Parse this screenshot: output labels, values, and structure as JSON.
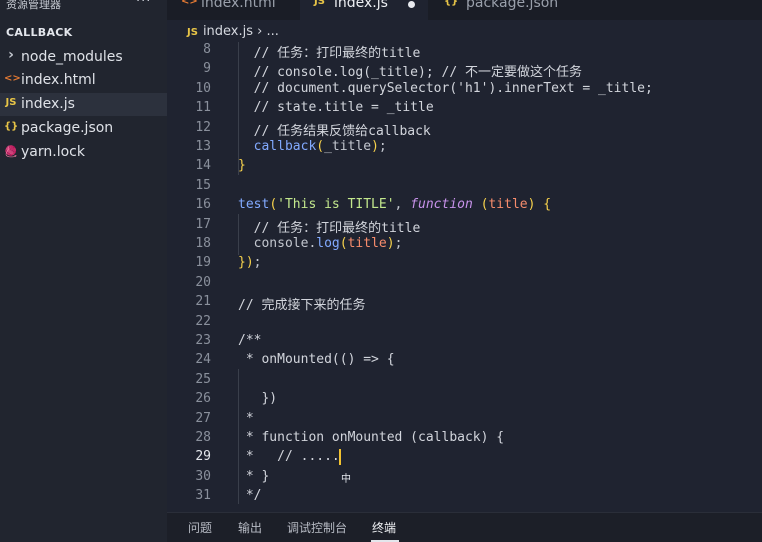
{
  "sidebar": {
    "title": "资源管理器",
    "more_label": "···",
    "section": "CALLBACK",
    "items": [
      {
        "icon": "›",
        "label": "node_modules",
        "icon_name": "chevron-right-icon"
      },
      {
        "icon": "<>",
        "label": "index.html",
        "icon_name": "html-file-icon"
      },
      {
        "icon": "JS",
        "label": "index.js",
        "icon_name": "js-file-icon"
      },
      {
        "icon": "{}",
        "label": "package.json",
        "icon_name": "json-file-icon"
      },
      {
        "icon": "🧶",
        "label": "yarn.lock",
        "icon_name": "yarn-file-icon"
      }
    ]
  },
  "tabs": [
    {
      "icon": "<>",
      "label": "index.html"
    },
    {
      "icon": "JS",
      "label": "index.js"
    },
    {
      "icon": "{}",
      "label": "package.json"
    }
  ],
  "breadcrumb": {
    "icon": "JS",
    "file": "index.js",
    "sep": "›",
    "rest": "..."
  },
  "colors": {
    "accent_js": "#e8c547",
    "accent_html": "#e37933",
    "accent_json": "#e8c547",
    "cursor": "#f2c230"
  },
  "editor": {
    "current_line": "29",
    "lines": [
      {
        "n": "8",
        "text": "  // 任务：打印最终的title"
      },
      {
        "n": "9",
        "text": "  // console.log(_title); // 不一定要做这个任务"
      },
      {
        "n": "10",
        "text": "  // document.querySelector('h1').innerText = _title;"
      },
      {
        "n": "11",
        "text": "  // state.title = _title"
      },
      {
        "n": "12",
        "text": "  // 任务结果反馈给callback"
      },
      {
        "n": "13",
        "text": "  callback(_title);"
      },
      {
        "n": "14",
        "text": "}"
      },
      {
        "n": "15",
        "text": ""
      },
      {
        "n": "16",
        "text": "test('This is TITLE', function (title) {"
      },
      {
        "n": "17",
        "text": "  // 任务：打印最终的title"
      },
      {
        "n": "18",
        "text": "  console.log(title);"
      },
      {
        "n": "19",
        "text": "});"
      },
      {
        "n": "20",
        "text": ""
      },
      {
        "n": "21",
        "text": "// 完成接下来的任务"
      },
      {
        "n": "22",
        "text": ""
      },
      {
        "n": "23",
        "text": "/**"
      },
      {
        "n": "24",
        "text": " * onMounted(() => {"
      },
      {
        "n": "25",
        "text": ""
      },
      {
        "n": "26",
        "text": "   })"
      },
      {
        "n": "27",
        "text": " *"
      },
      {
        "n": "28",
        "text": " * function onMounted (callback) {"
      },
      {
        "n": "29",
        "text": " *   // ....."
      },
      {
        "n": "30",
        "text": " * }"
      },
      {
        "n": "31",
        "text": " */"
      }
    ]
  },
  "ime_indicator": "中",
  "panel": {
    "tabs": [
      "问题",
      "输出",
      "调试控制台",
      "终端"
    ],
    "active": "终端"
  }
}
